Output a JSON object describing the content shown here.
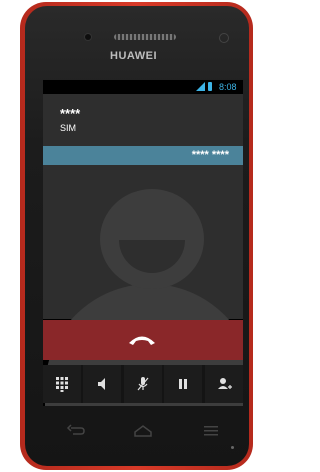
{
  "device": {
    "brand": "HUAWEI"
  },
  "status_bar": {
    "time": "8:08",
    "accent_color": "#3db4e6"
  },
  "call": {
    "caller_name": "****",
    "caller_label": "SIM",
    "phone_number": "****  ****",
    "end_call_color": "#8a2729"
  },
  "controls": [
    {
      "name": "dialpad-icon"
    },
    {
      "name": "speaker-icon"
    },
    {
      "name": "mute-icon"
    },
    {
      "name": "hold-icon"
    },
    {
      "name": "add-call-icon"
    }
  ],
  "nav": {
    "back": "back-icon",
    "home": "home-icon",
    "menu": "menu-icon"
  }
}
